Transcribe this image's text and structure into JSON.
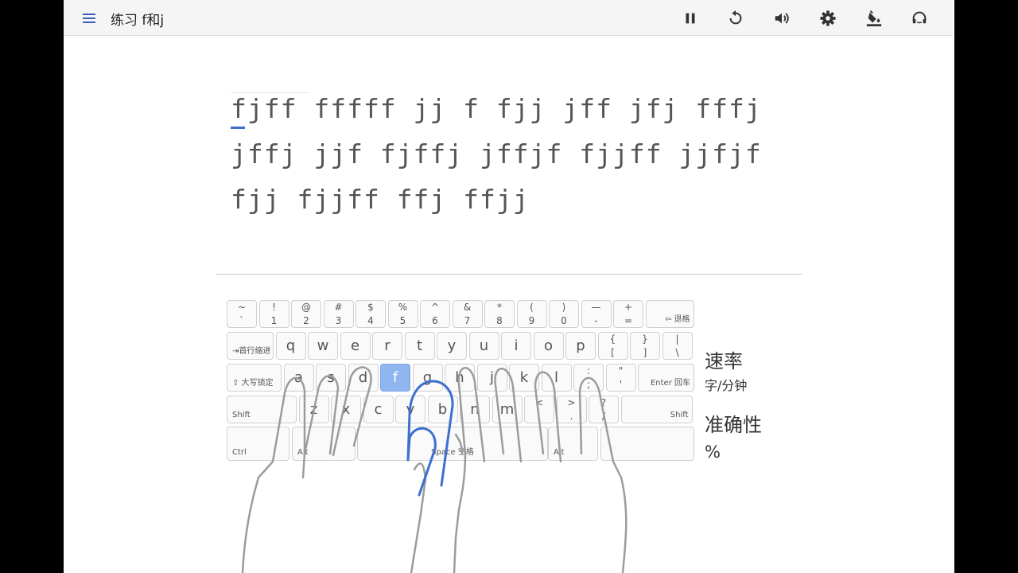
{
  "header": {
    "title": "练习 f和j",
    "buttons": [
      {
        "name": "pause-button",
        "icon": "pause-icon"
      },
      {
        "name": "restart-button",
        "icon": "restart-icon"
      },
      {
        "name": "sound-button",
        "icon": "volume-icon"
      },
      {
        "name": "settings-button",
        "icon": "gear-icon"
      },
      {
        "name": "theme-button",
        "icon": "paint-bucket-icon"
      },
      {
        "name": "support-button",
        "icon": "headset-icon"
      }
    ]
  },
  "practice": {
    "lines": [
      "fjff fffff jj f fjj jff jfj fffj",
      "jffj jjf fjffj jffjf fjjff jjfjf",
      "fjj fjjff ffj ffjj"
    ]
  },
  "keyboard": {
    "active_key": "f",
    "accent_color": "#3d6fd0",
    "rows": [
      [
        {
          "top": "~",
          "bottom": "`"
        },
        {
          "top": "!",
          "bottom": "1"
        },
        {
          "top": "@",
          "bottom": "2"
        },
        {
          "top": "#",
          "bottom": "3"
        },
        {
          "top": "$",
          "bottom": "4"
        },
        {
          "top": "%",
          "bottom": "5"
        },
        {
          "top": "^",
          "bottom": "6"
        },
        {
          "top": "&",
          "bottom": "7"
        },
        {
          "top": "*",
          "bottom": "8"
        },
        {
          "top": "(",
          "bottom": "9"
        },
        {
          "top": ")",
          "bottom": "0"
        },
        {
          "top": "—",
          "bottom": "-"
        },
        {
          "top": "+",
          "bottom": "="
        },
        {
          "label": "⇦ 退格"
        }
      ],
      [
        {
          "label": "⇥首行缩进"
        },
        {
          "char": "q"
        },
        {
          "char": "w"
        },
        {
          "char": "e"
        },
        {
          "char": "r"
        },
        {
          "char": "t"
        },
        {
          "char": "y"
        },
        {
          "char": "u"
        },
        {
          "char": "i"
        },
        {
          "char": "o"
        },
        {
          "char": "p"
        },
        {
          "top": "{",
          "bottom": "["
        },
        {
          "top": "}",
          "bottom": "]"
        },
        {
          "top": "|",
          "bottom": "\\"
        }
      ],
      [
        {
          "label": "⇪ 大写锁定"
        },
        {
          "char": "a"
        },
        {
          "char": "s"
        },
        {
          "char": "d"
        },
        {
          "char": "f"
        },
        {
          "char": "g"
        },
        {
          "char": "h"
        },
        {
          "char": "j"
        },
        {
          "char": "k"
        },
        {
          "char": "l"
        },
        {
          "top": ":",
          "bottom": ";"
        },
        {
          "top": "\"",
          "bottom": "'"
        },
        {
          "label": "Enter 回车"
        }
      ],
      [
        {
          "label": "Shift"
        },
        {
          "char": "z"
        },
        {
          "char": "x"
        },
        {
          "char": "c"
        },
        {
          "char": "v"
        },
        {
          "char": "b"
        },
        {
          "char": "n"
        },
        {
          "char": "m"
        },
        {
          "top": "<",
          "bottom": ","
        },
        {
          "top": ">",
          "bottom": "."
        },
        {
          "top": "?",
          "bottom": "/"
        },
        {
          "label": "Shift"
        }
      ],
      [
        {
          "label": "Ctrl"
        },
        {
          "label": "Alt"
        },
        {
          "label": "Space 空格"
        },
        {
          "label": "Alt"
        },
        {
          "label": ""
        }
      ]
    ]
  },
  "stats": {
    "speed_label": "速率",
    "speed_unit": "字/分钟",
    "accuracy_label": "准确性",
    "accuracy_unit": "%"
  }
}
